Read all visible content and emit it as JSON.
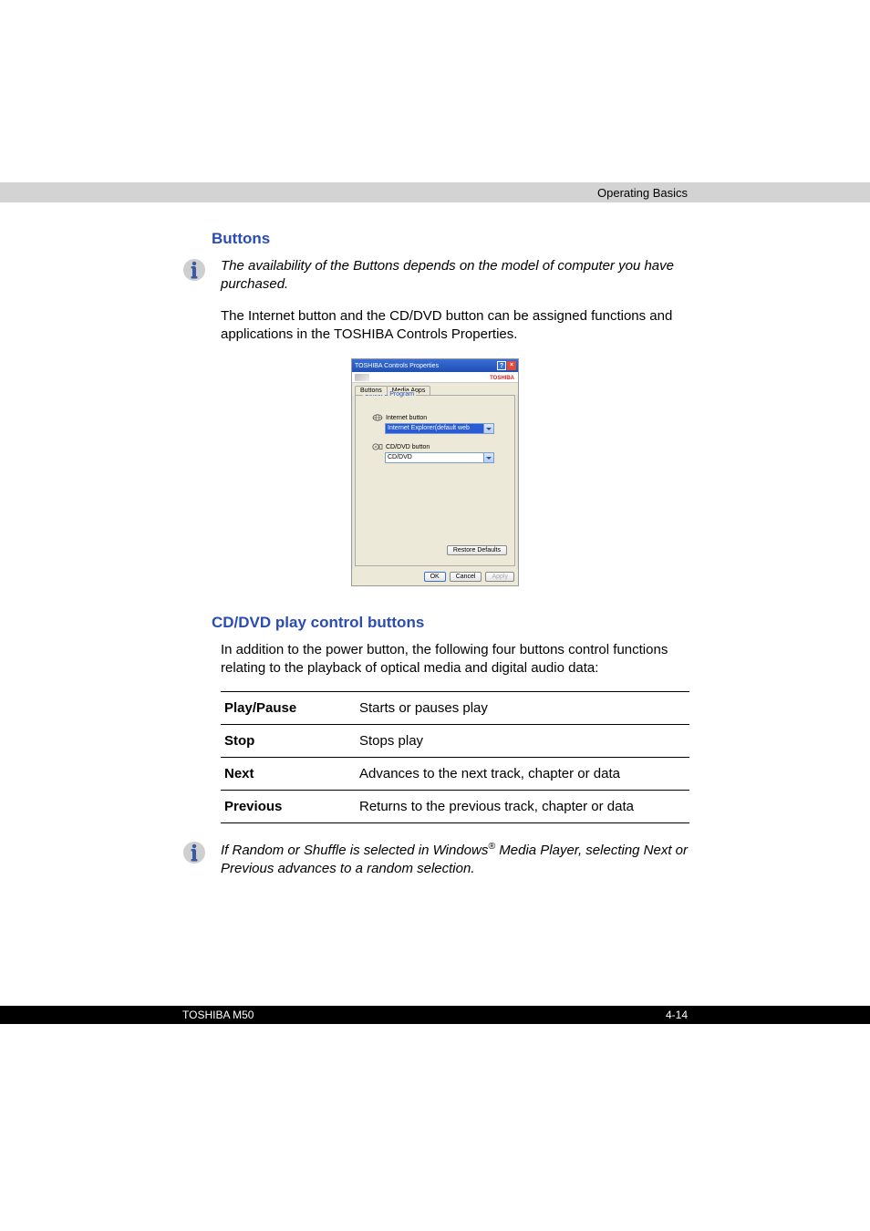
{
  "header": {
    "section": "Operating Basics"
  },
  "s1": {
    "title": "Buttons",
    "note": "The availability of the Buttons depends on the model of computer you have purchased.",
    "body": "The Internet button and the CD/DVD button can be assigned functions and applications in the TOSHIBA Controls Properties."
  },
  "dialog": {
    "title": "TOSHIBA Controls Properties",
    "brand": "TOSHIBA",
    "tabs": {
      "a": "Buttons",
      "b": "Media Apps"
    },
    "group": "Select a Program",
    "f1": {
      "label": "Internet button",
      "value": "Internet Explorer(default web browser)"
    },
    "f2": {
      "label": "CD/DVD button",
      "value": "CD/DVD"
    },
    "restore": "Restore Defaults",
    "ok": "OK",
    "cancel": "Cancel",
    "apply": "Apply"
  },
  "s2": {
    "title": "CD/DVD play control buttons",
    "body": "In addition to the power button, the following four buttons control functions relating to the playback of optical media and digital audio data:",
    "rows": [
      {
        "k": "Play/Pause",
        "v": "Starts or pauses play"
      },
      {
        "k": "Stop",
        "v": "Stops play"
      },
      {
        "k": "Next",
        "v": "Advances to the next track, chapter or data"
      },
      {
        "k": "Previous",
        "v": "Returns to the previous track, chapter or data"
      }
    ],
    "note_a": "If Random or Shuffle is selected in Windows",
    "note_sup": "®",
    "note_b": " Media Player, selecting Next or Previous advances to a random selection."
  },
  "footer": {
    "left": "TOSHIBA M50",
    "right": "4-14"
  }
}
